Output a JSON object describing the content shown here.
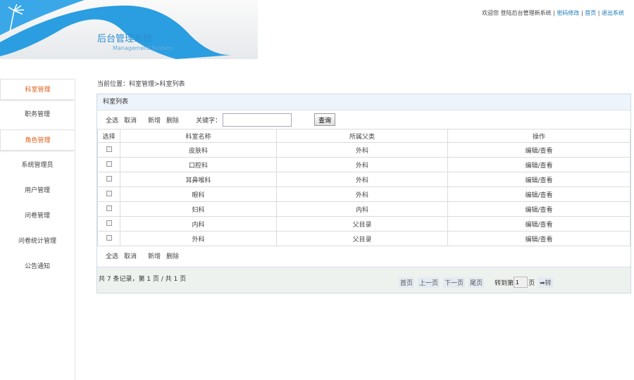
{
  "header": {
    "title": "后台管理系统",
    "subtitle": "Management System",
    "welcome": "欢迎您 登陆后台管理新系统",
    "links": [
      "密码修改",
      "首页",
      "退出系统"
    ]
  },
  "sidebar": {
    "items": [
      {
        "label": "科室管理",
        "active": true
      },
      {
        "label": "职务管理"
      },
      {
        "label": "角色管理",
        "active": true
      },
      {
        "label": "系统管理员"
      },
      {
        "label": "用户管理"
      },
      {
        "label": "问卷管理"
      },
      {
        "label": "问卷统计管理"
      },
      {
        "label": "公告通知"
      }
    ]
  },
  "breadcrumb": "当前位置：科室管理>科室列表",
  "panel": {
    "title": "科室列表",
    "select_all": "全选",
    "cancel": "取消",
    "add": "新增",
    "delete": "删除",
    "keyword_label": "关键字：",
    "keyword_value": "",
    "search": "查询"
  },
  "table": {
    "headers": [
      "选择",
      "科室名称",
      "所属父类",
      "操作"
    ],
    "rows": [
      [
        "皮肤科",
        "外科",
        "编辑/查看"
      ],
      [
        "口腔科",
        "外科",
        "编辑/查看"
      ],
      [
        "耳鼻喉科",
        "外科",
        "编辑/查看"
      ],
      [
        "眼科",
        "外科",
        "编辑/查看"
      ],
      [
        "妇科",
        "内科",
        "编辑/查看"
      ],
      [
        "内科",
        "父目录",
        "编辑/查看"
      ],
      [
        "外科",
        "父目录",
        "编辑/查看"
      ]
    ]
  },
  "footer": {
    "count": "共 7 条记录，第 1 页 / 共 1 页",
    "first": "首页",
    "prev": "上一页",
    "next": "下一页",
    "last": "尾页",
    "goto": "转到第",
    "page_value": "1",
    "page_unit": "页",
    "go": "➡转"
  }
}
